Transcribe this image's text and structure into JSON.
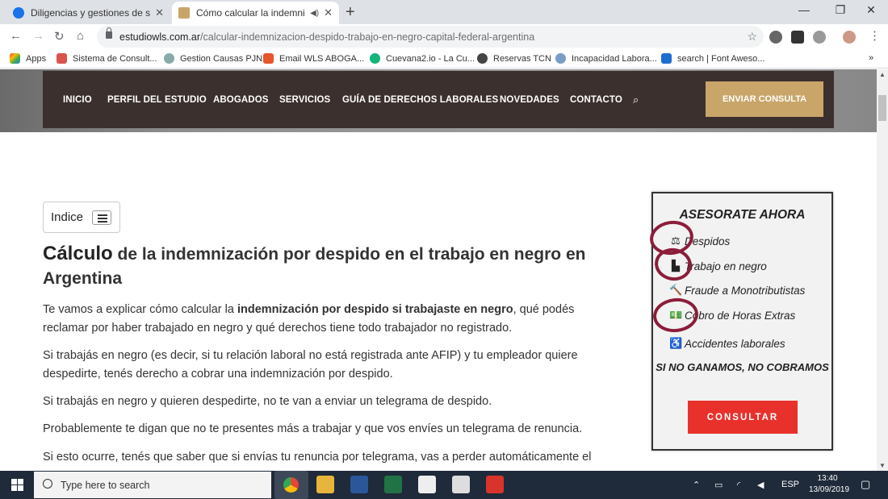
{
  "browser": {
    "tabs": [
      {
        "title": "Diligencias y gestiones de socied",
        "active": false
      },
      {
        "title": "Cómo calcular la indemnizac",
        "active": true
      }
    ],
    "url_host": "estudiowls.com.ar",
    "url_path": "/calcular-indemnizacion-despido-trabajo-en-negro-capital-federal-argentina",
    "bookmarks": [
      "Apps",
      "Sistema de Consult...",
      "Gestion Causas PJN",
      "Email WLS ABOGA...",
      "Cuevana2.io - La Cu...",
      "Reservas TCN",
      "Incapacidad Labora...",
      "search | Font Aweso..."
    ],
    "bookmarks_overflow": "»"
  },
  "site": {
    "nav": [
      "INICIO",
      "PERFIL DEL ESTUDIO",
      "ABOGADOS",
      "SERVICIOS",
      "GUÍA DE DERECHOS LABORALES",
      "NOVEDADES",
      "CONTACTO"
    ],
    "cta": "ENVIAR CONSULTA",
    "indice": "Indice",
    "headline_lead": "Cálculo",
    "headline_rest": " de la indemnización por despido en el trabajo en negro en Argentina",
    "p1_a": "Te vamos a explicar cómo calcular la ",
    "p1_b": "indemnización por despido si trabajaste en negro",
    "p1_c": ", qué podés reclamar por haber trabajado en negro y qué derechos tiene todo trabajador no registrado.",
    "p2": "Si trabajás en negro (es decir, si tu relación laboral no está registrada ante AFIP) y tu empleador quiere despedirte, tenés derecho a cobrar una indemnización por despido.",
    "p3": "Si trabajás en negro y quieren despedirte, no te van a enviar un telegrama de despido.",
    "p4": "Probablemente te digan que no te presentes más a trabajar y que vos envíes un telegrama de renuncia.",
    "p5": "Si esto ocurre, tenés que saber que si envías tu renuncia por telegrama, vas a perder automáticamente el"
  },
  "widget": {
    "title": "ASESORATE AHORA",
    "items": [
      {
        "icon": "scale-icon",
        "glyph": "⚖",
        "label": "Despidos"
      },
      {
        "icon": "factory-icon",
        "glyph": "▙",
        "label": "Trabajo en negro"
      },
      {
        "icon": "gavel-icon",
        "glyph": "🔨",
        "label": "Fraude a Monotributistas"
      },
      {
        "icon": "money-icon",
        "glyph": "💵",
        "label": "Cobro de Horas Extras"
      },
      {
        "icon": "wheelchair-icon",
        "glyph": "♿",
        "label": "Accidentes laborales"
      }
    ],
    "tagline": "SI NO GANAMOS, NO COBRAMOS",
    "button": "CONSULTAR"
  },
  "taskbar": {
    "search_placeholder": "Type here to search",
    "language": "ESP",
    "time": "13:40",
    "date": "13/09/2019"
  },
  "colors": {
    "nav_bg": "#3b302d",
    "cta_bg": "#c9a56a",
    "consultar_bg": "#e8312b",
    "annotation": "#8c1d3a"
  }
}
